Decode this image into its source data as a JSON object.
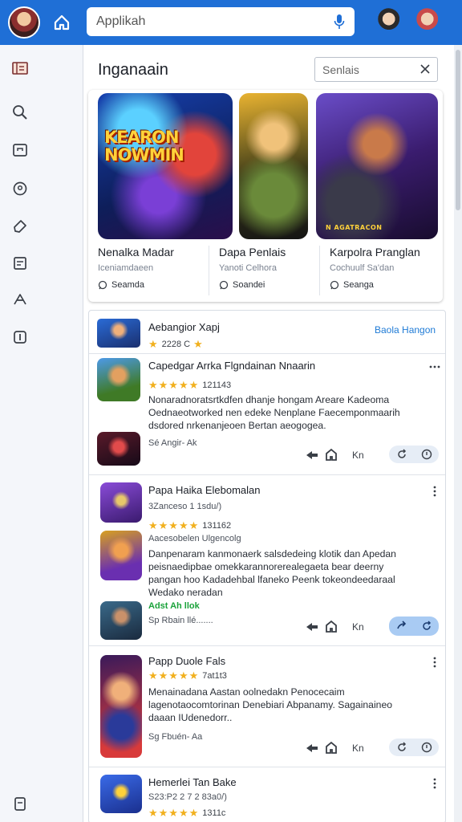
{
  "header": {
    "search_placeholder": "Applikah",
    "icons": [
      "home-icon",
      "mic-icon"
    ]
  },
  "featured": {
    "title": "Inganaain",
    "filter_placeholder": "Senlais",
    "logo_text": "KEARON NOWMIN",
    "art3_text": "N AGATRACON",
    "cards": [
      {
        "name": "Nenalka Madar",
        "subtitle": "Iceniamdaeen",
        "meta": "Seamda"
      },
      {
        "name": "Dapa Penlais",
        "subtitle": "Yanoti Celhora",
        "meta": "Soandei"
      },
      {
        "name": "Karpolra Pranglan",
        "subtitle": "Cochuulf Sa'dan",
        "meta": "Seanga"
      }
    ]
  },
  "list": {
    "header_item": {
      "title": "Aebangior Xapj",
      "rating": "2228 C",
      "link": "Baola Hangon"
    },
    "sections": [
      {
        "title": "Capedgar Arrka Flgndainan Nnaarin",
        "rating": "121143",
        "desc": "Nonaradnoratsrtkdfen dhanje hongam Areare Kadeoma Oednaeotworked nen edeke Nenplane Faecemponmaarih dsdored nrkenanjeoen Bertan aeogogea.",
        "footer": "Sé Angir- Ak",
        "action_label": "Kn"
      },
      {
        "title": "Papa Haika Elebomalan",
        "rating": "3Zanceso 1 1sdu/)",
        "rating2": "131162",
        "subtitle": "Aacesobelen Ulgencolg",
        "desc": "Danpenaram kanmonaerk salsdedeing klotik dan Apedan peisnaedipbae omekkarannorerealegaeta bear deerny pangan hoo Kadadehbal lfaneko Peenk tokeondeedaraal Wedako neradan",
        "green": "Adst Ah llok",
        "footer": "Sp Rbain llé.......",
        "action_label": "Kn"
      },
      {
        "title": "Papp Duole Fals",
        "rating": "7at1t3",
        "desc": "Menainadana Aastan oolnedakn Penocecaim lagenotaocomtorinan Denebiari Abpanamy. Sagainaineo daaan IUdenedorr..",
        "footer": "Sg Fbuén- Aa",
        "action_label": "Kn"
      },
      {
        "title": "Hemerlei Tan Bake",
        "rating": "S23:P2 2 7 2 83a0/)",
        "rating2": "1311c"
      }
    ]
  },
  "colors": {
    "brand": "#1f6fd6",
    "star": "#f1b01e",
    "link": "#1f7bd6",
    "green": "#1aa23a"
  }
}
